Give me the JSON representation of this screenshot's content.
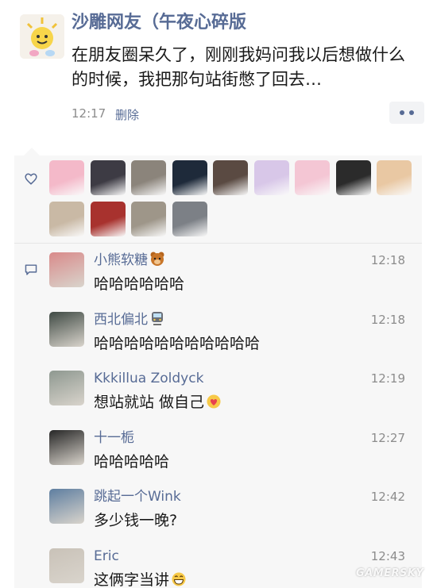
{
  "post": {
    "author": "沙雕网友（午夜心碎版",
    "text": "在朋友圈呆久了，刚刚我妈问我以后想做什么的时候，我把那句站街憋了回去…",
    "time": "12:17",
    "delete_label": "删除",
    "more_icon": "more-dots-icon"
  },
  "likes": {
    "icon": "heart-outline-icon",
    "avatar_colors": [
      "#f4b9c9",
      "#3d3b44",
      "#8b847b",
      "#1e2a3a",
      "#5a4a42",
      "#d8c7e8",
      "#f4c6d4",
      "#2b2b2b",
      "#e9c8a3",
      "#c9b9a5",
      "#a8322e",
      "#9e9689",
      "#7c8086"
    ]
  },
  "comments_icon": "comment-bubble-icon",
  "comments": [
    {
      "name": "小熊软糖",
      "emoji": "bear-face-emoji",
      "time": "12:18",
      "text": "哈哈哈哈哈哈",
      "text_emoji": "",
      "avatar_color": "#d98a8a"
    },
    {
      "name": "西北偏北",
      "emoji": "train-emoji",
      "time": "12:18",
      "text": "哈哈哈哈哈哈哈哈哈哈哈",
      "text_emoji": "",
      "avatar_color": "#3f4a44"
    },
    {
      "name": "Kkkillua Zoldyck",
      "emoji": "",
      "time": "12:19",
      "text": "想站就站 做自己",
      "text_emoji": "heart-hands-emoji",
      "avatar_color": "#8e9890"
    },
    {
      "name": "十一栀",
      "emoji": "",
      "time": "12:27",
      "text": "哈哈哈哈哈",
      "text_emoji": "",
      "avatar_color": "#262626"
    },
    {
      "name": "跳起一个Wink",
      "emoji": "",
      "time": "12:42",
      "text": "多少钱一晚?",
      "text_emoji": "",
      "avatar_color": "#5e7ea0"
    },
    {
      "name": "Eric",
      "emoji": "",
      "time": "12:43",
      "text": "这俩字当讲",
      "text_emoji": "grin-emoji",
      "avatar_color": "#c9c2b8"
    }
  ],
  "watermark": "GAMERSKY"
}
